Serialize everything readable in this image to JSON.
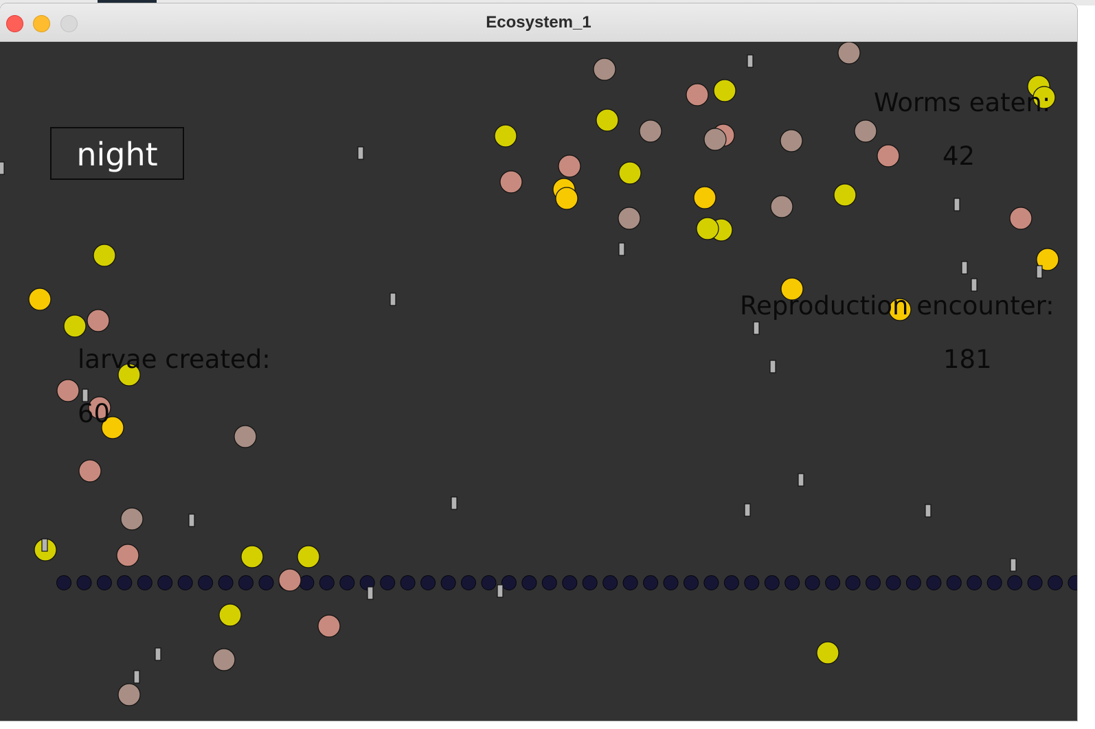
{
  "window": {
    "title": "Ecosystem_1",
    "controls": [
      "close-icon",
      "minimize-icon",
      "zoom-icon"
    ]
  },
  "simulation": {
    "mode_label": "night",
    "stats": {
      "worms_eaten_label": "Worms eaten:",
      "worms_eaten_value": "42",
      "reproduction_label": "Reproduction encounter:",
      "reproduction_value": "181",
      "larvae_label": "larvae created:",
      "larvae_value": "60"
    }
  },
  "colors": {
    "background": "#323232",
    "yellow_creature": "#d4d000",
    "gold_creature": "#f7c900",
    "pink_creature": "#c88a7e",
    "taupe_creature": "#a88e84",
    "worm": "#b3b3b3",
    "chain_dot": "#161634"
  }
}
